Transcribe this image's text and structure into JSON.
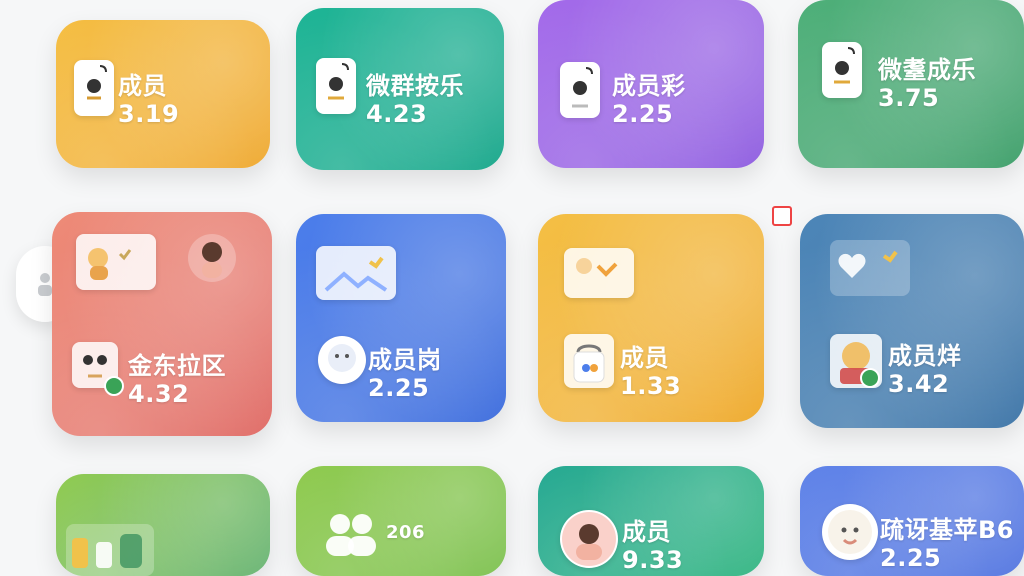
{
  "tiles": [
    {
      "title": "成员",
      "value": "3.19"
    },
    {
      "title": "微群按乐",
      "value": "4.23"
    },
    {
      "title": "成员彩",
      "value": "2.25"
    },
    {
      "title": "微耋成乐",
      "value": "3.75"
    },
    {
      "title": "金东拉区",
      "value": "4.32"
    },
    {
      "title": "成员岗",
      "value": "2.25"
    },
    {
      "title": "成员",
      "value": "1.33"
    },
    {
      "title": "成员烊",
      "value": "3.42"
    },
    {
      "title": "",
      "value": "206"
    },
    {
      "title": "成员",
      "value": "9.33"
    },
    {
      "title": "疏讶基苹B6",
      "value": "2.25"
    }
  ],
  "icons": {
    "side_handle": "user-icon",
    "doc": "document-icon",
    "image": "image-icon",
    "shopping": "bag-icon",
    "group": "users-icon",
    "face": "avatar-icon"
  },
  "colors": {
    "orange": "#F1B33A",
    "teal": "#1FB596",
    "purple": "#A46BEA",
    "green": "#4FB07A",
    "coral": "#E4736D",
    "blue": "#4C7EEB",
    "amber": "#F2B53A",
    "slate": "#4D86B8",
    "lime": "#8CC94A",
    "teal2": "#1FA68F",
    "indigo": "#5A7FE8"
  }
}
